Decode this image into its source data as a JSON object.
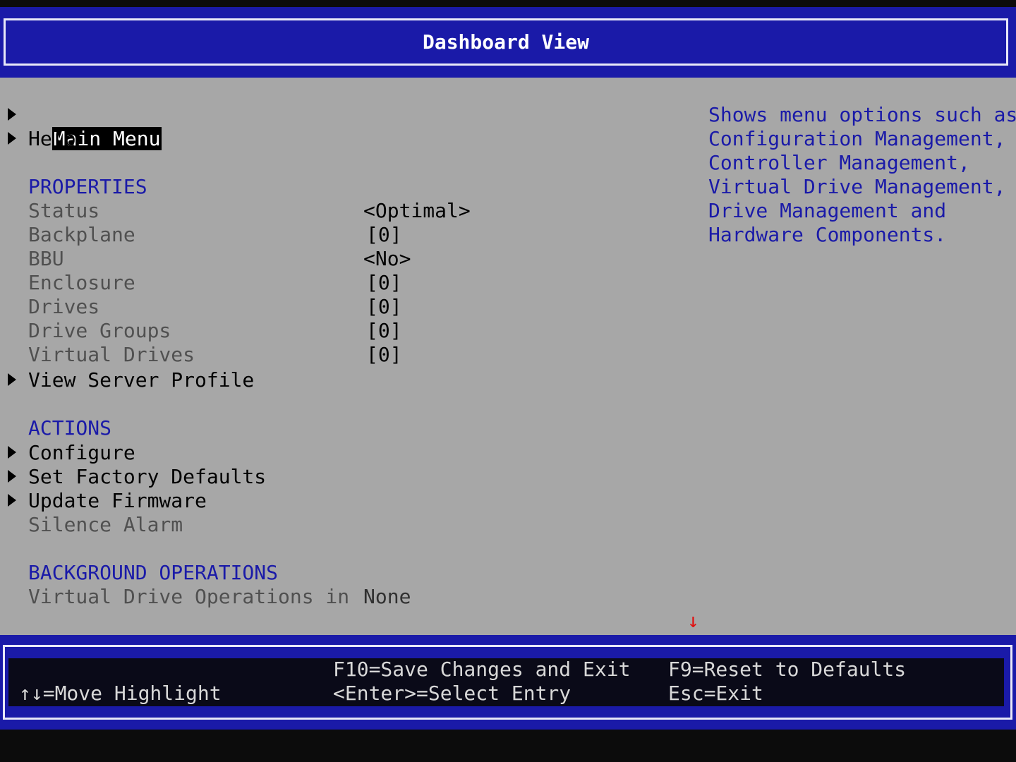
{
  "header": {
    "title": "Dashboard View"
  },
  "menu": {
    "main_menu": "Main Menu",
    "help": "Help"
  },
  "properties": {
    "section_title": "PROPERTIES",
    "rows": [
      {
        "label": "Status",
        "value": "<Optimal>"
      },
      {
        "label": "Backplane",
        "value": "[0]"
      },
      {
        "label": "BBU",
        "value": "<No>"
      },
      {
        "label": "Enclosure",
        "value": "[0]"
      },
      {
        "label": "Drives",
        "value": "[0]"
      },
      {
        "label": "Drive Groups",
        "value": "[0]"
      },
      {
        "label": "Virtual Drives",
        "value": "[0]"
      }
    ],
    "view_server_profile": "View Server Profile"
  },
  "actions": {
    "section_title": "ACTIONS",
    "configure": "Configure",
    "set_factory_defaults": "Set Factory Defaults",
    "update_firmware": "Update Firmware",
    "silence_alarm": "Silence Alarm"
  },
  "background_operations": {
    "section_title": "BACKGROUND OPERATIONS",
    "label": "Virtual Drive Operations in",
    "value": "None"
  },
  "help_panel": {
    "lines": [
      "Shows menu options such as",
      "Configuration Management,",
      "Controller Management,",
      "Virtual Drive Management,",
      "Drive Management and",
      "Hardware Components."
    ]
  },
  "scroll_indicator": "↓",
  "footer": {
    "move_highlight": "↑↓=Move Highlight",
    "save_exit": "F10=Save Changes and Exit",
    "select_entry": "<Enter>=Select Entry",
    "reset_defaults": "F9=Reset to Defaults",
    "exit": "Esc=Exit"
  },
  "colors": {
    "frame_blue": "#1a1aa8",
    "panel_gray": "#a7a7a7",
    "section_blue": "#1a1aa8",
    "scroll_red": "#e01010"
  }
}
